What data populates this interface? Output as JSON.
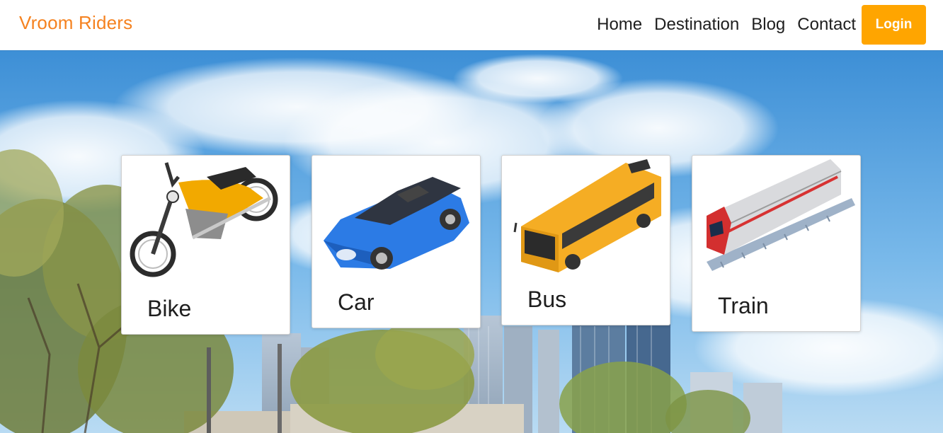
{
  "navbar": {
    "brand": "Vroom Riders",
    "links": [
      "Home",
      "Destination",
      "Blog",
      "Contact"
    ],
    "login_label": "Login"
  },
  "hero": {
    "cards": [
      {
        "title": "Bike",
        "icon": "motorbike-icon"
      },
      {
        "title": "Car",
        "icon": "car-icon"
      },
      {
        "title": "Bus",
        "icon": "bus-icon"
      },
      {
        "title": "Train",
        "icon": "train-icon"
      }
    ]
  },
  "colors": {
    "brand": "#f58220",
    "login_bg": "#ffa500",
    "sky": "#5aa7e0"
  }
}
